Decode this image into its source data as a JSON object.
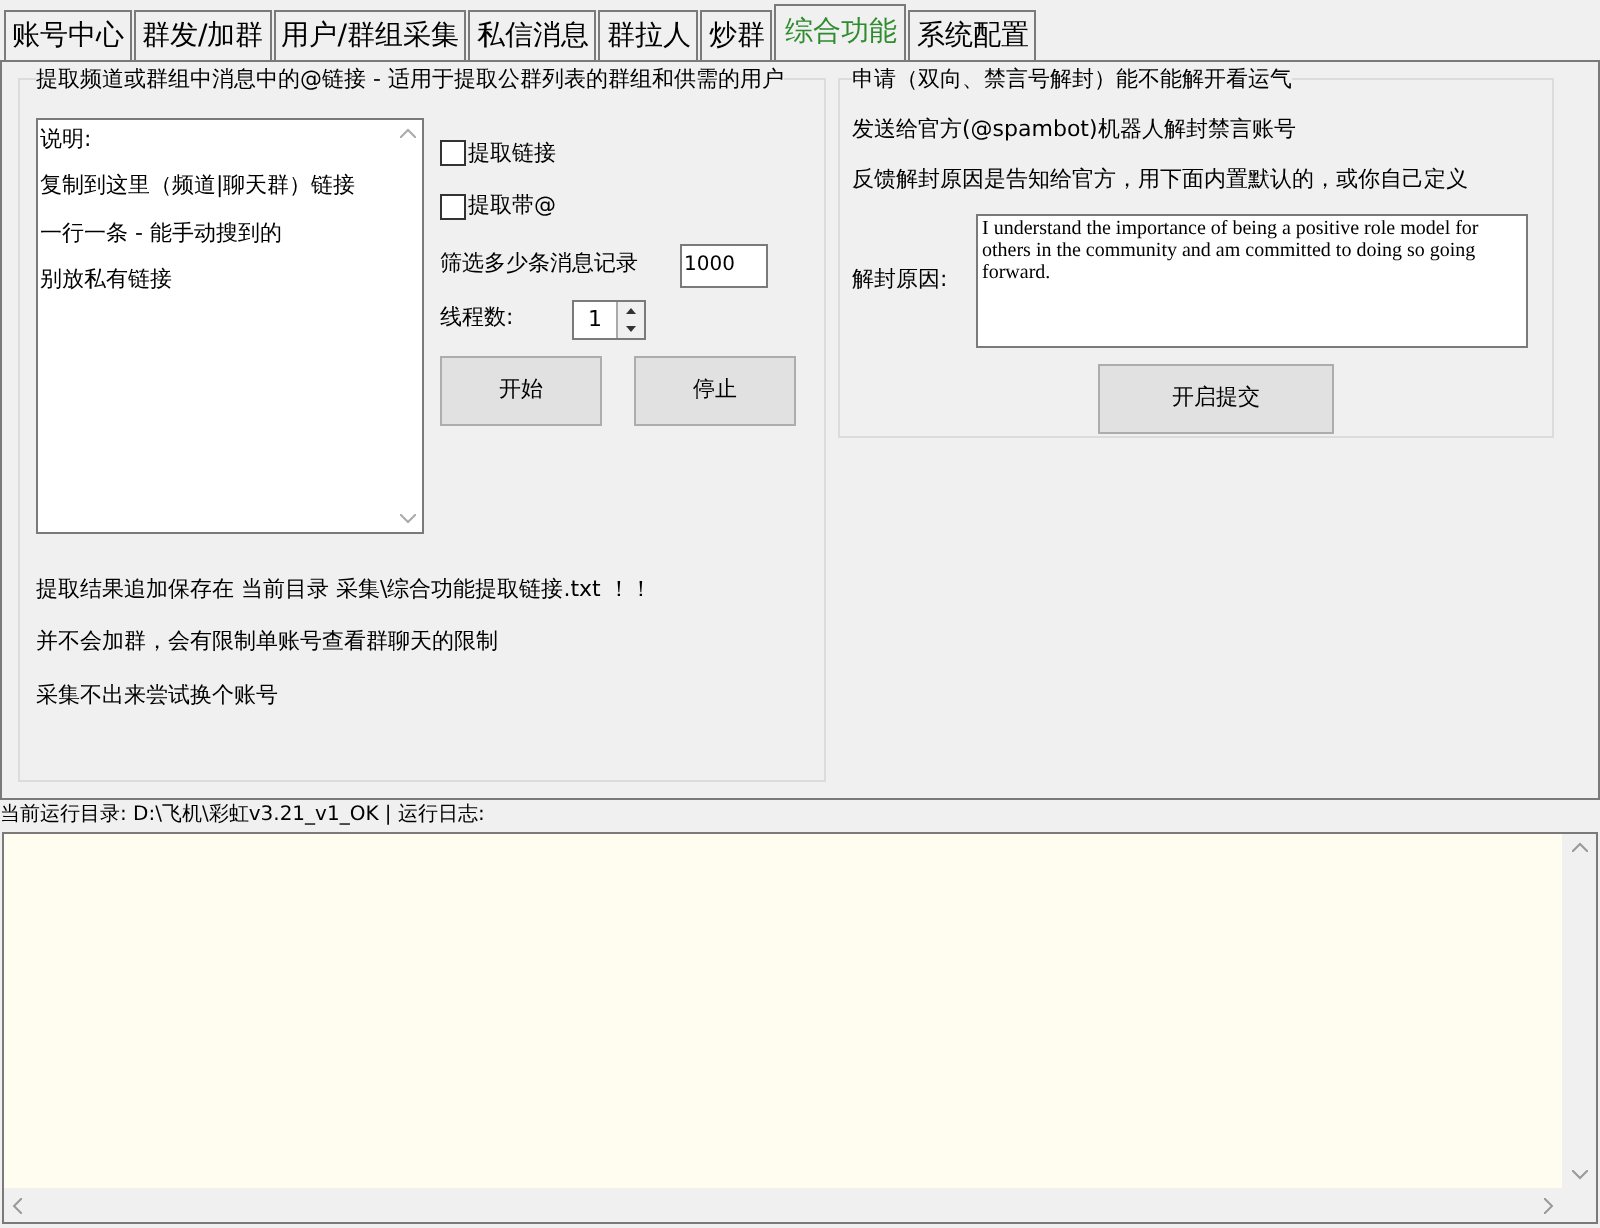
{
  "tabs": [
    {
      "label": "账号中心",
      "selected": false
    },
    {
      "label": "群发/加群",
      "selected": false
    },
    {
      "label": "用户/群组采集",
      "selected": false
    },
    {
      "label": "私信消息",
      "selected": false
    },
    {
      "label": "群拉人",
      "selected": false
    },
    {
      "label": "炒群",
      "selected": false
    },
    {
      "label": "综合功能",
      "selected": true
    },
    {
      "label": "系统配置",
      "selected": false
    }
  ],
  "extract_group": {
    "title": "提取频道或群组中消息中的@链接 - 适用于提取公群列表的群组和供需的用户",
    "links_box_lines": [
      "说明:",
      "复制到这里（频道|聊天群）链接",
      "一行一条 - 能手动搜到的",
      "别放私有链接"
    ],
    "options": [
      {
        "label": "提取链接",
        "checked": false
      },
      {
        "label": "提取带@",
        "checked": false
      }
    ],
    "filter_label": "筛选多少条消息记录",
    "filter_value": "1000",
    "threads_label": "线程数:",
    "threads_value": "1",
    "buttons": [
      "开始",
      "停止"
    ],
    "notes": [
      "提取结果追加保存在 当前目录 采集\\综合功能提取链接.txt ！！",
      "并不会加群，会有限制单账号查看群聊天的限制",
      "采集不出来尝试换个账号"
    ]
  },
  "unban_group": {
    "title": "申请（双向、禁言号解封）能不能解开看运气",
    "lines": [
      "发送给官方(@spambot)机器人解封禁言账号",
      "反馈解封原因是告知给官方，用下面内置默认的，或你自己定义"
    ],
    "reason_label": "解封原因:",
    "reason_value": "I understand the importance of being a positive role model for others in the community and am committed to doing so going forward.",
    "submit_button": "开启提交"
  },
  "status_line": "当前运行目录: D:\\飞机\\彩虹v3.21_v1_OK |  运行日志:"
}
